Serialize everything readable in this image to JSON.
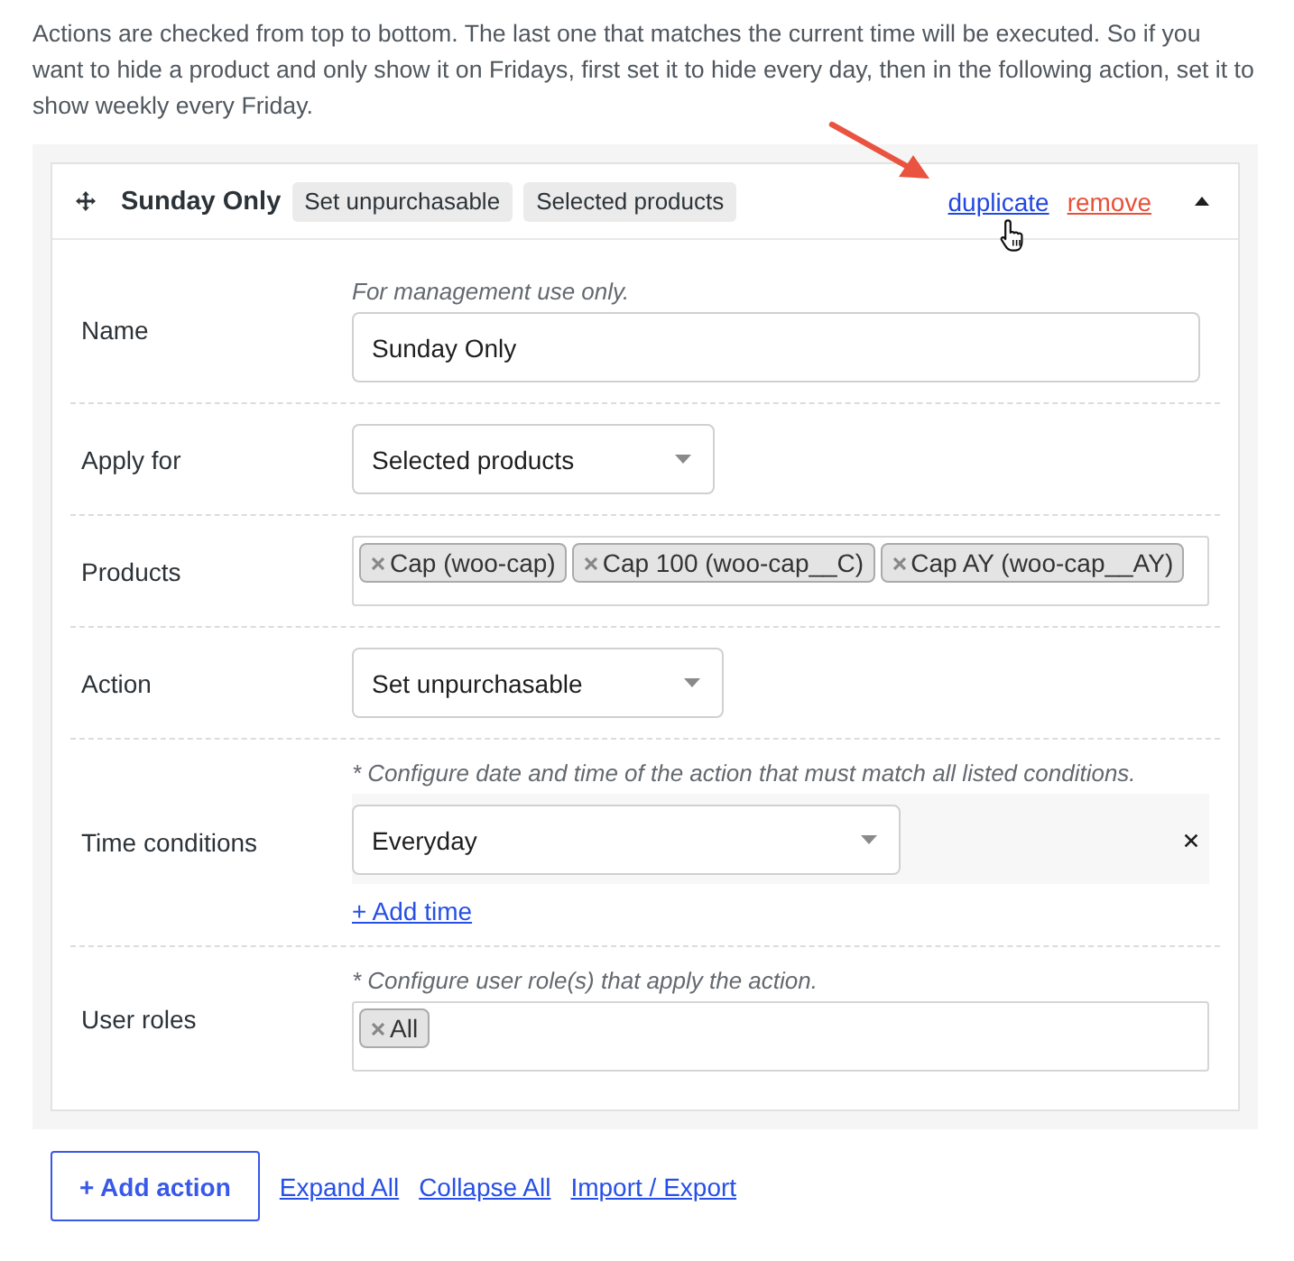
{
  "intro": "Actions are checked from top to bottom. The last one that matches the current time will be executed. So if you want to hide a product and only show it on Fridays, first set it to hide every day, then in the following action, set it to show weekly every Friday.",
  "action": {
    "title": "Sunday Only",
    "expanded": true,
    "badges": [
      "Set unpurchasable",
      "Selected products"
    ],
    "links": [
      {
        "label": "duplicate",
        "kind": "duplicate"
      },
      {
        "label": "remove",
        "kind": "remove"
      }
    ],
    "fields": [
      {
        "kind": "text",
        "label": "Name",
        "hint": "For management use only.",
        "value": "Sunday Only"
      },
      {
        "kind": "select",
        "label": "Apply for",
        "value": "Selected products"
      },
      {
        "kind": "tags",
        "label": "Products",
        "tags": [
          "Cap (woo-cap)",
          "Cap 100 (woo-cap__C)",
          "Cap AY (woo-cap__AY)"
        ]
      },
      {
        "kind": "select",
        "label": "Action",
        "value": "Set unpurchasable"
      },
      {
        "kind": "time",
        "label": "Time conditions",
        "hint": "* Configure date and time of the action that must match all listed conditions.",
        "conditions": [
          {
            "value": "Everyday"
          }
        ],
        "add_link": "+ Add time"
      },
      {
        "kind": "tags",
        "label": "User roles",
        "hint": "* Configure user role(s) that apply the action.",
        "tags": [
          "All"
        ]
      }
    ]
  },
  "footer": {
    "add_button": "+ Add action",
    "links": [
      "Expand All",
      "Collapse All",
      "Import / Export"
    ]
  }
}
